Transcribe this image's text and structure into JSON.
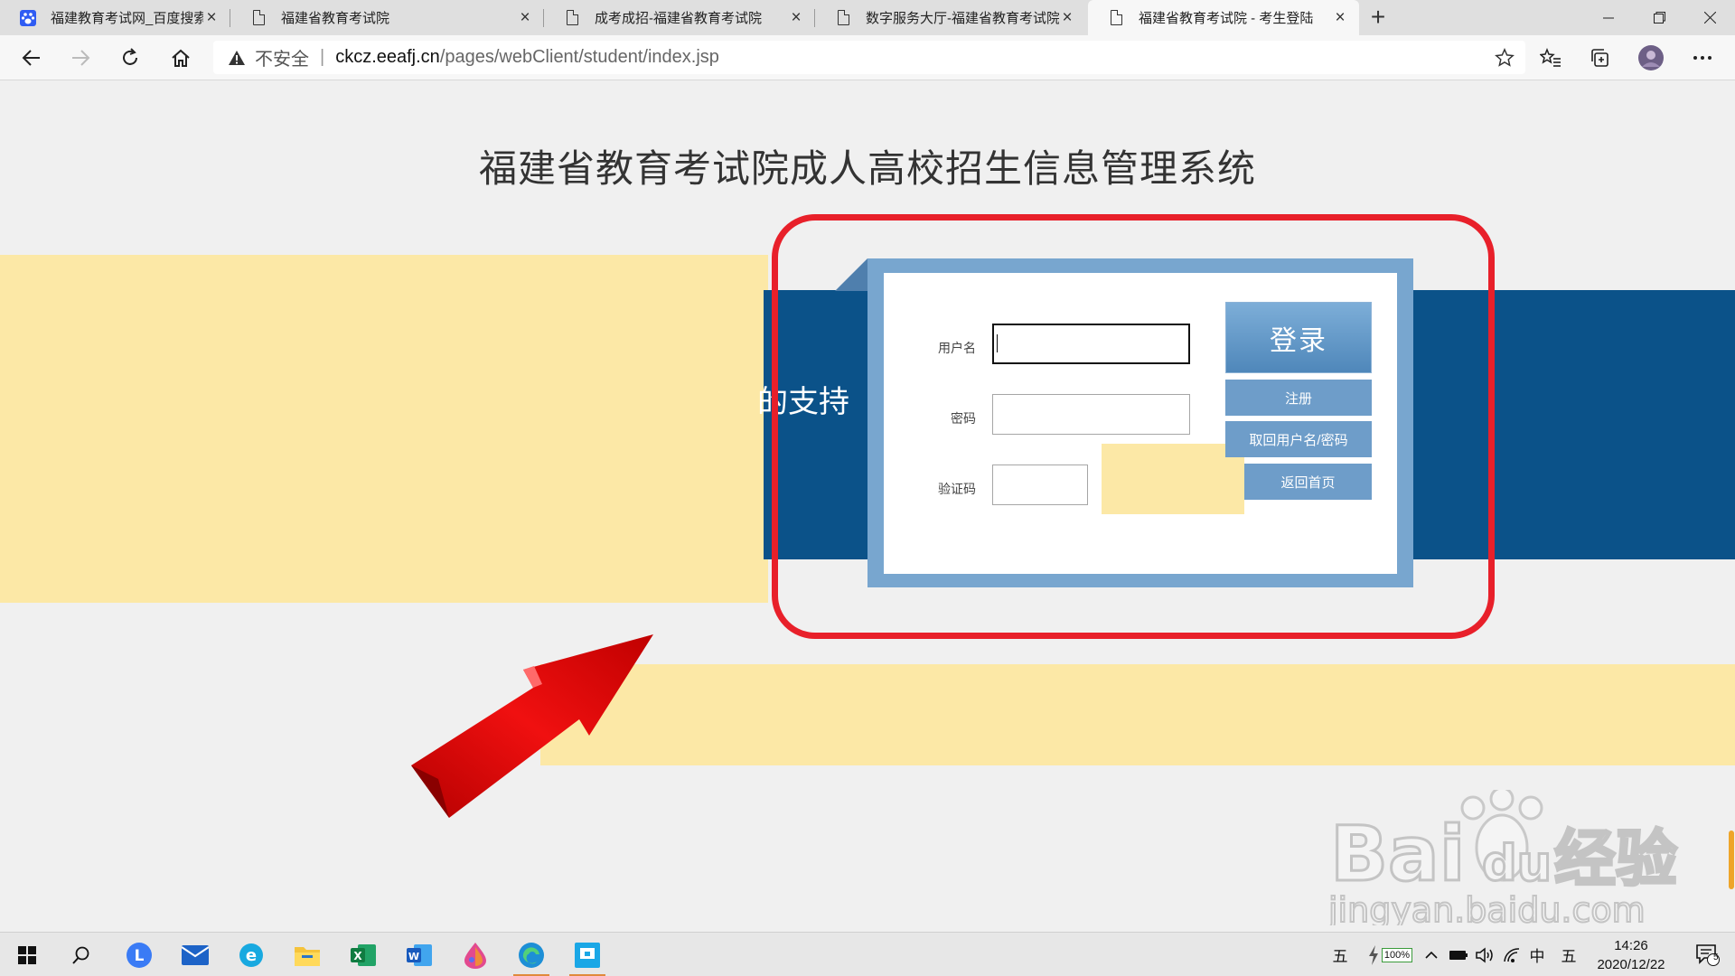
{
  "browser": {
    "tabs": [
      {
        "title": "福建教育考试网_百度搜索",
        "icon": "baidu-paw-icon",
        "active": false
      },
      {
        "title": "福建省教育考试院",
        "icon": "page-icon",
        "active": false
      },
      {
        "title": "成考成招-福建省教育考试院",
        "icon": "page-icon",
        "active": false
      },
      {
        "title": "数字服务大厅-福建省教育考试院",
        "icon": "page-icon",
        "active": false
      },
      {
        "title": "福建省教育考试院 - 考生登陆",
        "icon": "page-icon",
        "active": true
      }
    ],
    "address": {
      "security_label": "不安全",
      "host": "ckcz.eeafj.cn",
      "path": "/pages/webClient/student/index.jsp"
    }
  },
  "page": {
    "title": "福建省教育考试院成人高校招生信息管理系统",
    "banner_text": "的支持",
    "form": {
      "username_label": "用户名",
      "username_value": "",
      "password_label": "密码",
      "password_value": "",
      "captcha_label": "验证码",
      "captcha_value": ""
    },
    "buttons": {
      "login": "登录",
      "register": "注册",
      "recover": "取回用户名/密码",
      "home": "返回首页"
    },
    "watermark": {
      "brand": "Bai",
      "brand_tail": "经验",
      "url": "jingyan.baidu.com"
    }
  },
  "colors": {
    "banner_blue": "#0b5289",
    "frame_blue": "#78a6cf",
    "button_blue": "#6e9dc9",
    "highlight_red": "#e8202a",
    "pale_yellow": "#fce8a6"
  },
  "taskbar": {
    "apps": [
      "windows-start-icon",
      "search-icon",
      "lark-icon",
      "mail-icon",
      "ie-icon",
      "file-explorer-icon",
      "excel-icon",
      "word-icon",
      "paint-icon",
      "edge-icon",
      "app-icon"
    ],
    "tray": {
      "ime_left": "五",
      "battery": "100%",
      "lang": "中",
      "ime_right": "五",
      "time": "14:26",
      "date": "2020/12/22",
      "notifications": "5"
    }
  }
}
